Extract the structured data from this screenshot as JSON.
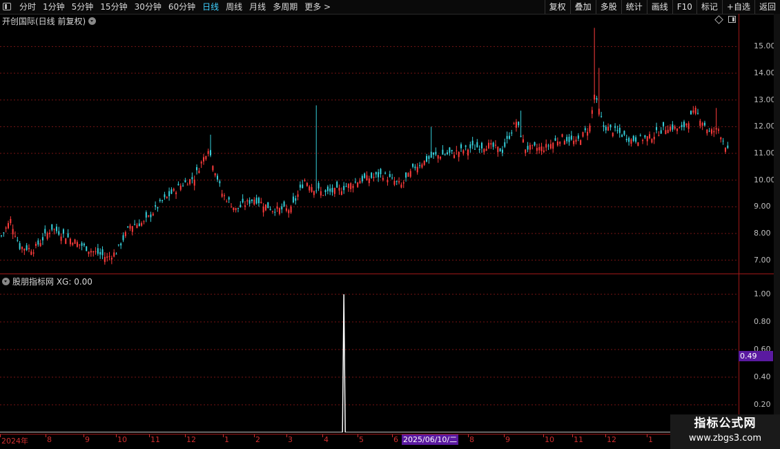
{
  "toolbar": {
    "periods": [
      {
        "label": "分时",
        "active": false
      },
      {
        "label": "1分钟",
        "active": false
      },
      {
        "label": "5分钟",
        "active": false
      },
      {
        "label": "15分钟",
        "active": false
      },
      {
        "label": "30分钟",
        "active": false
      },
      {
        "label": "60分钟",
        "active": false
      },
      {
        "label": "日线",
        "active": true
      },
      {
        "label": "周线",
        "active": false
      },
      {
        "label": "月线",
        "active": false
      },
      {
        "label": "多周期",
        "active": false
      },
      {
        "label": "更多 >",
        "active": false
      }
    ],
    "actions": [
      "复权",
      "叠加",
      "多股",
      "统计",
      "画线",
      "F10",
      "标记",
      "+自选",
      "返回"
    ]
  },
  "main_panel": {
    "title": "开创国际(日线 前复权)"
  },
  "indicator_panel": {
    "title": "股朋指标网 XG: 0.00",
    "value_tag": "0.49"
  },
  "colors": {
    "up": "#ff3c3c",
    "down": "#36d1dc",
    "grid": "#7a1414",
    "accent": "#5a1aa0",
    "active_tab": "#3fd0ff"
  },
  "date_axis": {
    "ticks": [
      "2024年",
      "8",
      "9",
      "10",
      "11",
      "12",
      "1",
      "2",
      "3",
      "4",
      "5",
      "6",
      "8",
      "9",
      "10",
      "11",
      "12",
      "1"
    ],
    "cursor": "2025/06/10/二"
  },
  "watermark": {
    "title": "指标公式网",
    "url": "www.zbgs3.com"
  },
  "chart_data": [
    {
      "type": "candlestick",
      "title": "开创国际(日线 前复权)",
      "y_ticks": [
        "15.00",
        "14.00",
        "13.00",
        "12.00",
        "11.00",
        "10.00",
        "9.00",
        "8.00",
        "7.00"
      ],
      "ylim": [
        6.5,
        16.2
      ],
      "x_months": [
        "2024年",
        "8",
        "9",
        "10",
        "11",
        "12",
        "1",
        "2",
        "3",
        "4",
        "5",
        "6",
        "7",
        "8",
        "9",
        "10",
        "11",
        "12",
        "1"
      ],
      "anchors": [
        {
          "i": 0,
          "c": 7.9
        },
        {
          "i": 4,
          "c": 8.5
        },
        {
          "i": 8,
          "c": 7.5
        },
        {
          "i": 14,
          "c": 7.4
        },
        {
          "i": 22,
          "c": 8.2
        },
        {
          "i": 30,
          "c": 7.8
        },
        {
          "i": 38,
          "c": 7.4
        },
        {
          "i": 46,
          "c": 7.1
        },
        {
          "i": 50,
          "c": 7.3
        },
        {
          "i": 56,
          "c": 8.3
        },
        {
          "i": 62,
          "c": 8.4
        },
        {
          "i": 70,
          "c": 9.2
        },
        {
          "i": 78,
          "c": 9.8
        },
        {
          "i": 84,
          "c": 10.1
        },
        {
          "i": 90,
          "c": 11.2
        },
        {
          "i": 96,
          "c": 9.5
        },
        {
          "i": 102,
          "c": 8.9
        },
        {
          "i": 110,
          "c": 9.3
        },
        {
          "i": 118,
          "c": 8.9
        },
        {
          "i": 126,
          "c": 8.9
        },
        {
          "i": 132,
          "c": 10.0
        },
        {
          "i": 136,
          "c": 9.7
        },
        {
          "i": 140,
          "c": 9.5
        },
        {
          "i": 146,
          "c": 9.6
        },
        {
          "i": 156,
          "c": 10.0
        },
        {
          "i": 166,
          "c": 10.2
        },
        {
          "i": 174,
          "c": 9.8
        },
        {
          "i": 180,
          "c": 10.5
        },
        {
          "i": 188,
          "c": 10.9
        },
        {
          "i": 196,
          "c": 11.0
        },
        {
          "i": 204,
          "c": 11.2
        },
        {
          "i": 212,
          "c": 11.3
        },
        {
          "i": 218,
          "c": 11.1
        },
        {
          "i": 224,
          "c": 12.2
        },
        {
          "i": 228,
          "c": 11.2
        },
        {
          "i": 236,
          "c": 11.2
        },
        {
          "i": 244,
          "c": 11.6
        },
        {
          "i": 250,
          "c": 11.4
        },
        {
          "i": 256,
          "c": 12.0
        },
        {
          "i": 258,
          "c": 13.2
        },
        {
          "i": 262,
          "c": 12.0
        },
        {
          "i": 268,
          "c": 11.8
        },
        {
          "i": 274,
          "c": 11.5
        },
        {
          "i": 282,
          "c": 11.6
        },
        {
          "i": 290,
          "c": 12.0
        },
        {
          "i": 296,
          "c": 11.9
        },
        {
          "i": 302,
          "c": 12.6
        },
        {
          "i": 308,
          "c": 11.8
        },
        {
          "i": 312,
          "c": 11.9
        },
        {
          "i": 316,
          "c": 11.1
        }
      ],
      "spikes": [
        {
          "i": 91,
          "high": 11.7
        },
        {
          "i": 137,
          "high": 12.8
        },
        {
          "i": 187,
          "high": 12.0
        },
        {
          "i": 226,
          "high": 12.6
        },
        {
          "i": 258,
          "high": 15.7
        },
        {
          "i": 260,
          "high": 14.2
        },
        {
          "i": 311,
          "high": 12.7
        }
      ]
    },
    {
      "type": "line",
      "title": "股朋指标网 XG: 0.00",
      "y_ticks": [
        "1.00",
        "0.80",
        "0.60",
        "0.40",
        "0.20"
      ],
      "ylim": [
        0,
        1.05
      ],
      "points": [
        {
          "i": 149,
          "value": 1.0
        }
      ]
    }
  ]
}
